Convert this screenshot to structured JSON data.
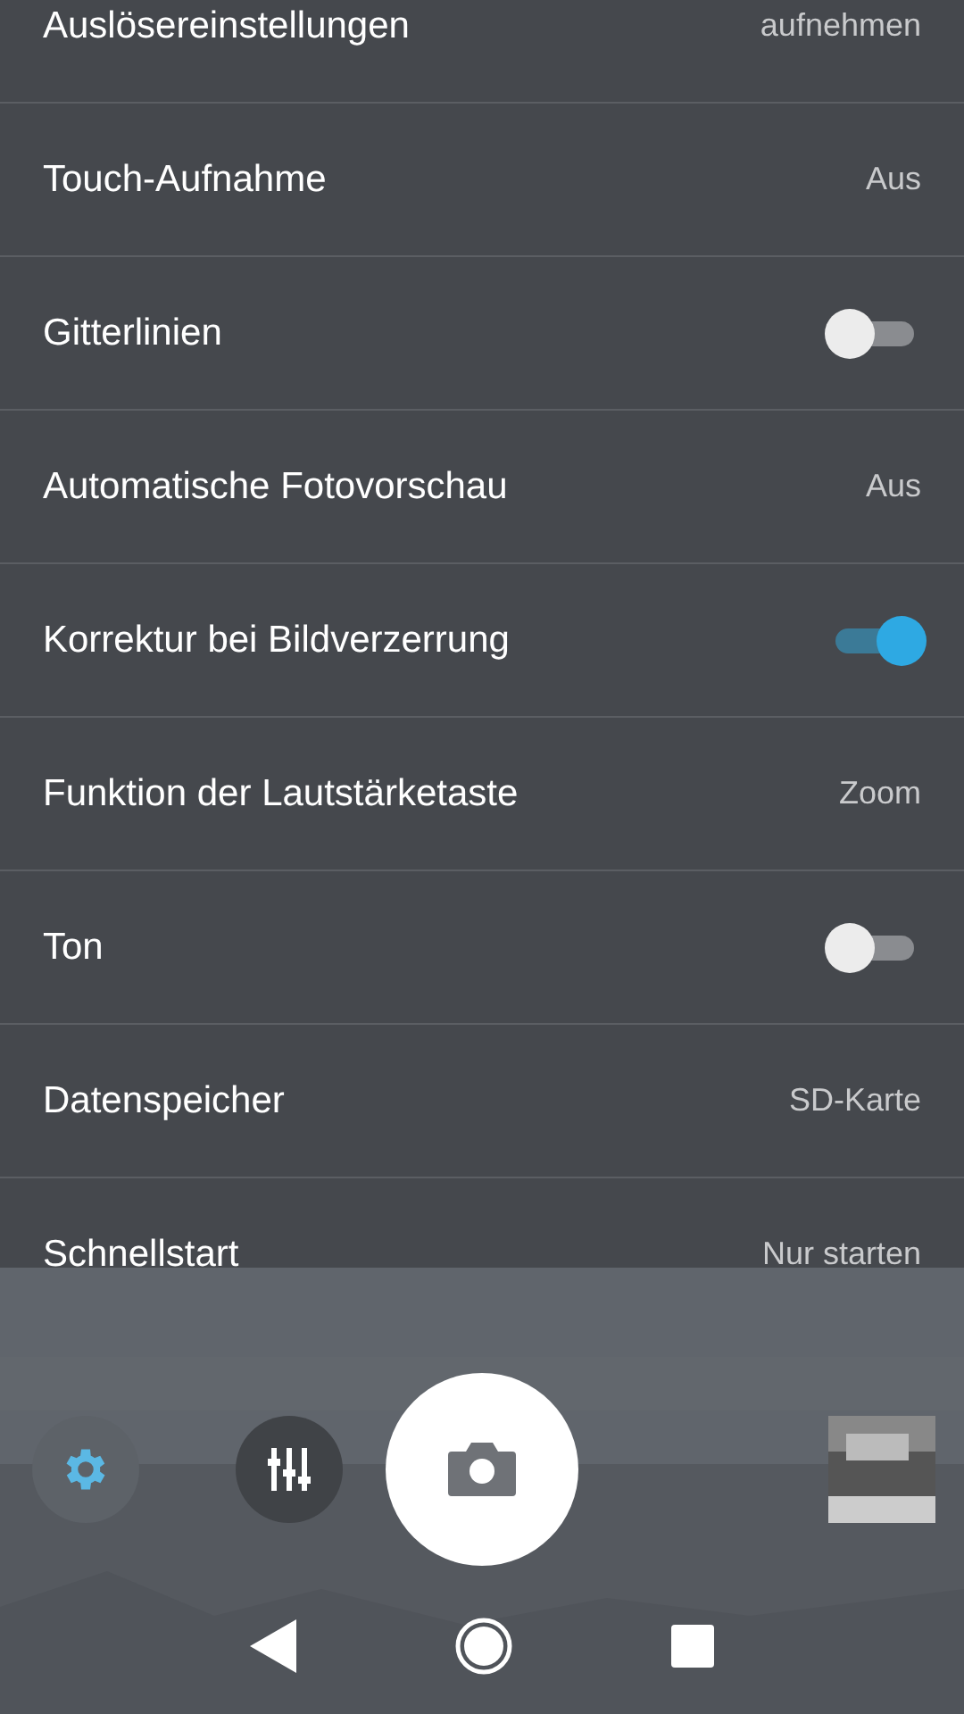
{
  "settings": [
    {
      "label": "Auslösereinstellungen",
      "kind": "value",
      "value": "aufnehmen"
    },
    {
      "label": "Touch-Aufnahme",
      "kind": "value",
      "value": "Aus"
    },
    {
      "label": "Gitterlinien",
      "kind": "toggle",
      "on": false
    },
    {
      "label": "Automatische Fotovorschau",
      "kind": "value",
      "value": "Aus"
    },
    {
      "label": "Korrektur bei Bildverzerrung",
      "kind": "toggle",
      "on": true
    },
    {
      "label": "Funktion der Lautstärketaste",
      "kind": "value",
      "value": "Zoom"
    },
    {
      "label": "Ton",
      "kind": "toggle",
      "on": false
    },
    {
      "label": "Datenspeicher",
      "kind": "value",
      "value": "SD-Karte"
    },
    {
      "label": "Schnellstart",
      "kind": "value",
      "value": "Nur starten"
    }
  ],
  "camera_controls": {
    "settings_selected": true
  }
}
